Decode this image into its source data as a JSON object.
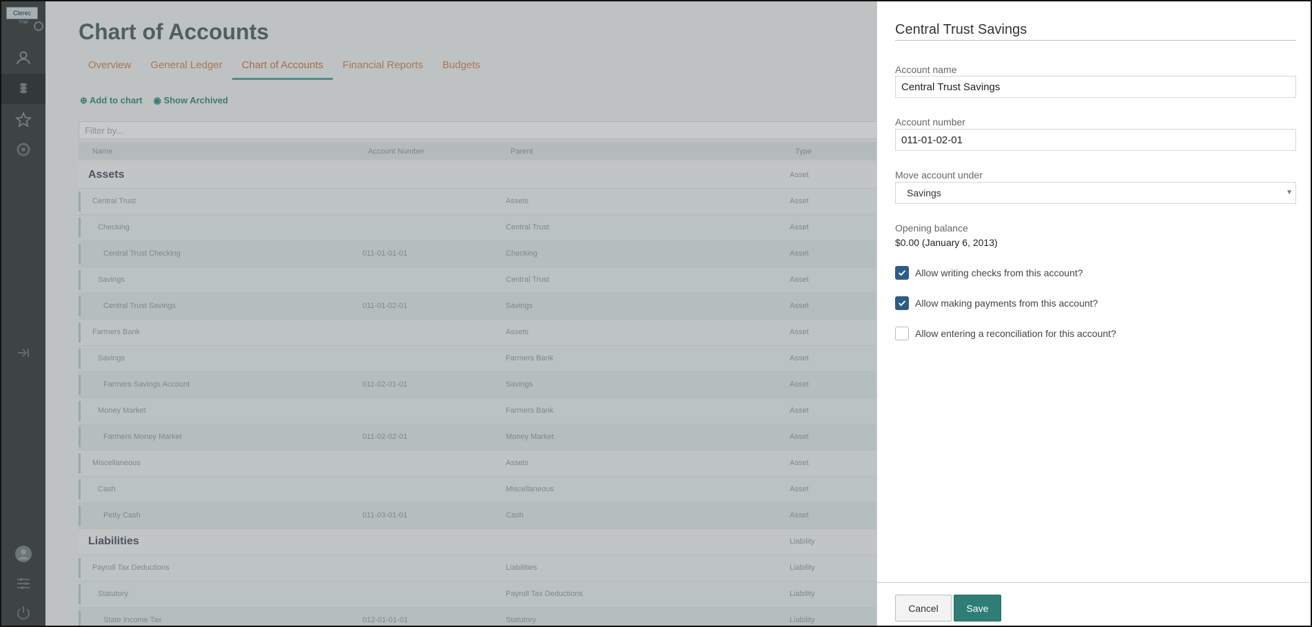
{
  "app": {
    "logo_text": "Clerec",
    "logo_subtext": "Trial"
  },
  "page": {
    "title": "Chart of Accounts",
    "tabs": [
      {
        "label": "Overview"
      },
      {
        "label": "General Ledger"
      },
      {
        "label": "Chart of Accounts",
        "active": true
      },
      {
        "label": "Financial Reports"
      },
      {
        "label": "Budgets"
      }
    ],
    "actions": {
      "add_label": "Add to chart",
      "archived_label": "Show Archived"
    },
    "filter_placeholder": "Filter by...",
    "columns": {
      "name": "Name",
      "account_number": "Account Number",
      "parent": "Parent",
      "type": "Type"
    },
    "rows": [
      {
        "name": "Assets",
        "number": "",
        "parent": "",
        "type": "Asset",
        "group": true
      },
      {
        "name": "Central Trust",
        "number": "",
        "parent": "Assets",
        "type": "Asset",
        "level": 1
      },
      {
        "name": "Checking",
        "number": "",
        "parent": "Central Trust",
        "type": "Asset",
        "level": 2
      },
      {
        "name": "Central Trust Checking",
        "number": "011-01-01-01",
        "parent": "Checking",
        "type": "Asset",
        "level": 3
      },
      {
        "name": "Savings",
        "number": "",
        "parent": "Central Trust",
        "type": "Asset",
        "level": 2
      },
      {
        "name": "Central Trust Savings",
        "number": "011-01-02-01",
        "parent": "Savings",
        "type": "Asset",
        "level": 3
      },
      {
        "name": "Farmers Bank",
        "number": "",
        "parent": "Assets",
        "type": "Asset",
        "level": 1
      },
      {
        "name": "Savings",
        "number": "",
        "parent": "Farmers Bank",
        "type": "Asset",
        "level": 2
      },
      {
        "name": "Farmers Savings Account",
        "number": "011-02-01-01",
        "parent": "Savings",
        "type": "Asset",
        "level": 3
      },
      {
        "name": "Money Market",
        "number": "",
        "parent": "Farmers Bank",
        "type": "Asset",
        "level": 2
      },
      {
        "name": "Farmers Money Market",
        "number": "011-02-02-01",
        "parent": "Money Market",
        "type": "Asset",
        "level": 3
      },
      {
        "name": "Miscellaneous",
        "number": "",
        "parent": "Assets",
        "type": "Asset",
        "level": 1
      },
      {
        "name": "Cash",
        "number": "",
        "parent": "Miscellaneous",
        "type": "Asset",
        "level": 2
      },
      {
        "name": "Petty Cash",
        "number": "011-03-01-01",
        "parent": "Cash",
        "type": "Asset",
        "level": 3
      },
      {
        "name": "Liabilities",
        "number": "",
        "parent": "",
        "type": "Liability",
        "group": true
      },
      {
        "name": "Payroll Tax Deductions",
        "number": "",
        "parent": "Liabilities",
        "type": "Liability",
        "level": 1
      },
      {
        "name": "Statutory",
        "number": "",
        "parent": "Payroll Tax Deductions",
        "type": "Liability",
        "level": 2
      },
      {
        "name": "State Income Tax",
        "number": "012-01-01-01",
        "parent": "Statutory",
        "type": "Liability",
        "level": 3
      }
    ]
  },
  "panel": {
    "title": "Central Trust Savings",
    "account_name_label": "Account name",
    "account_name_value": "Central Trust Savings",
    "account_number_label": "Account number",
    "account_number_value": "011-01-02-01",
    "move_under_label": "Move account under",
    "move_under_value": "Savings",
    "opening_balance_label": "Opening balance",
    "opening_balance_value": "$0.00 (January 6, 2013)",
    "checkboxes": [
      {
        "label": "Allow writing checks from this account?",
        "checked": true
      },
      {
        "label": "Allow making payments from this account?",
        "checked": true
      },
      {
        "label": "Allow entering a reconciliation for this account?",
        "checked": false
      }
    ],
    "cancel_label": "Cancel",
    "save_label": "Save"
  },
  "colors": {
    "accent": "#2e7d77",
    "checkbox_on": "#2d5d86",
    "tab_text": "#d0784a"
  }
}
